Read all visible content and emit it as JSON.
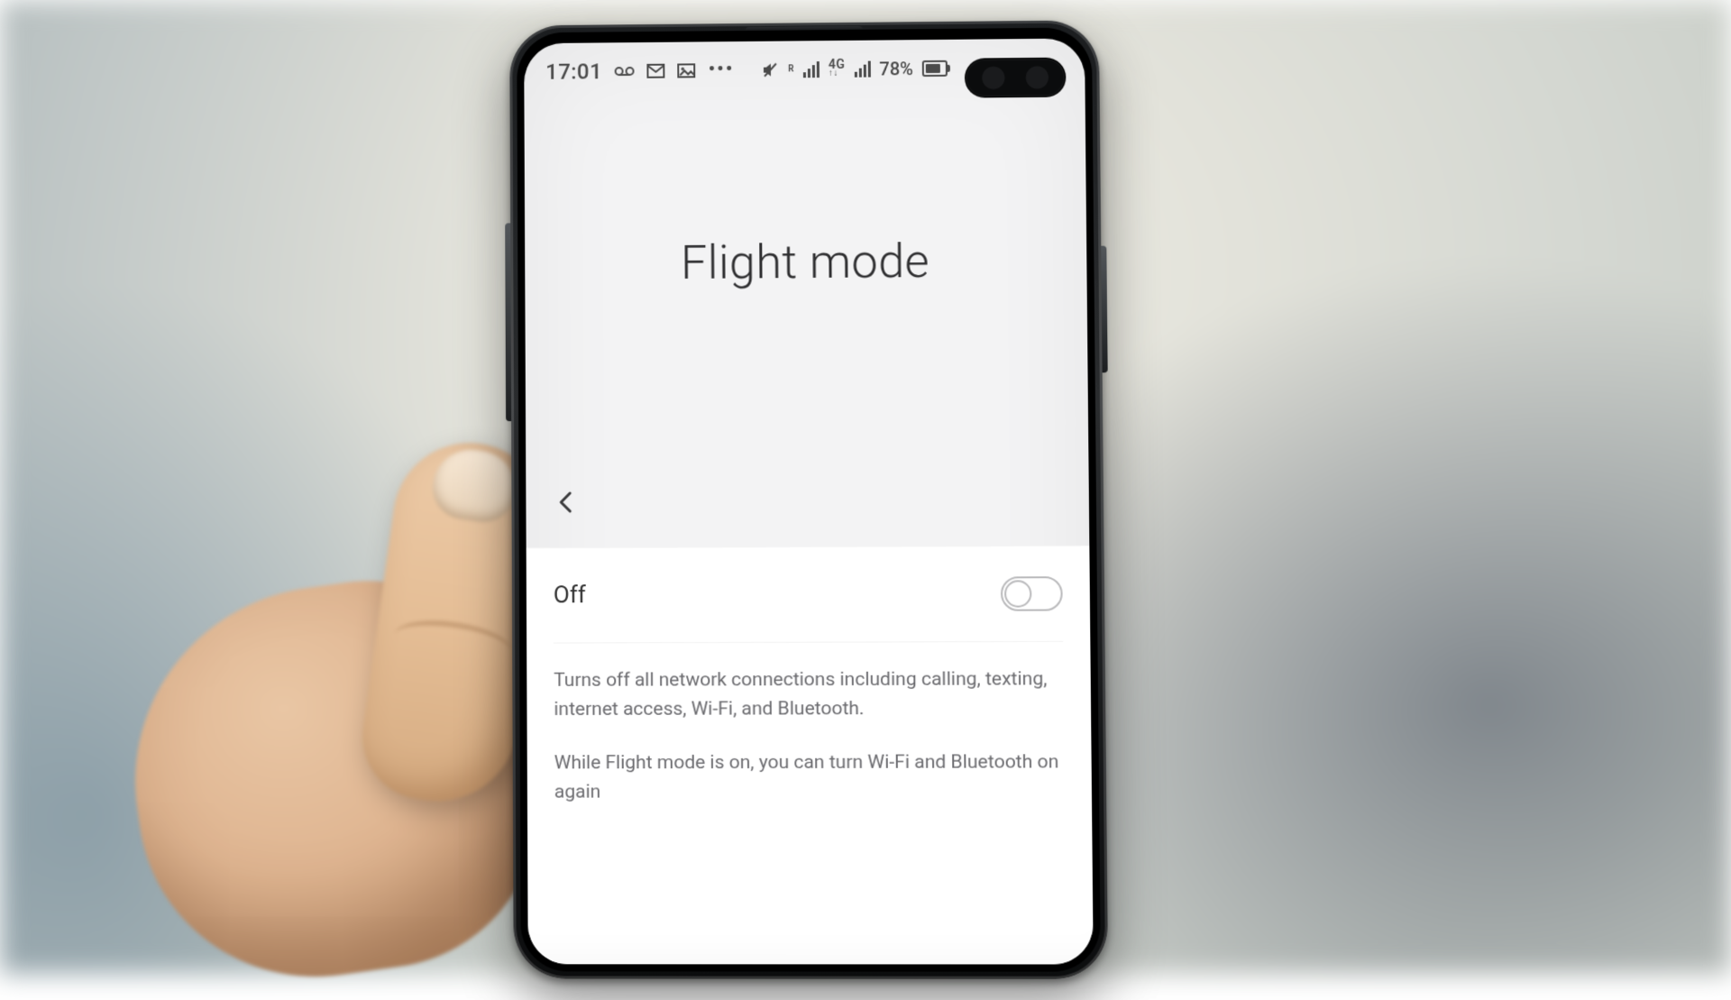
{
  "statusbar": {
    "time": "17:01",
    "more_dots": "•••",
    "roaming_badge_top": "R",
    "network_top": "4G",
    "network_bottom": "↑↓",
    "battery_percent_text": "78%",
    "battery_fill_pct": 78
  },
  "page": {
    "title": "Flight mode"
  },
  "toggle": {
    "label": "Off",
    "on": false
  },
  "description": {
    "p1": "Turns off all network connections including calling, texting, internet access, Wi-Fi, and Bluetooth.",
    "p2": "While Flight mode is on, you can turn Wi-Fi and Bluetooth on again"
  }
}
